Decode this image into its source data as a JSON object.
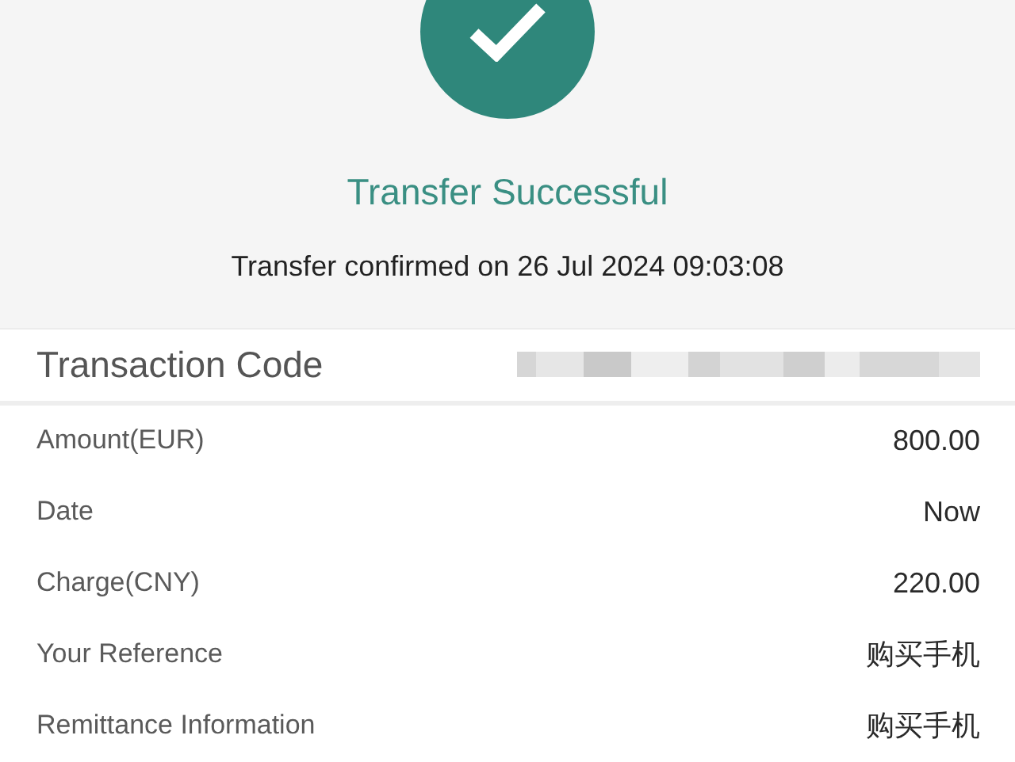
{
  "status": {
    "title": "Transfer Successful",
    "message": "Transfer confirmed on 26 Jul 2024 09:03:08",
    "success": true
  },
  "transaction_code": {
    "label": "Transaction Code",
    "redacted": true
  },
  "details": [
    {
      "label": "Amount(EUR)",
      "value": "800.00"
    },
    {
      "label": "Date",
      "value": "Now"
    },
    {
      "label": "Charge(CNY)",
      "value": "220.00"
    },
    {
      "label": "Your Reference",
      "value": "购买手机"
    },
    {
      "label": "Remittance Information",
      "value": "购买手机"
    }
  ]
}
